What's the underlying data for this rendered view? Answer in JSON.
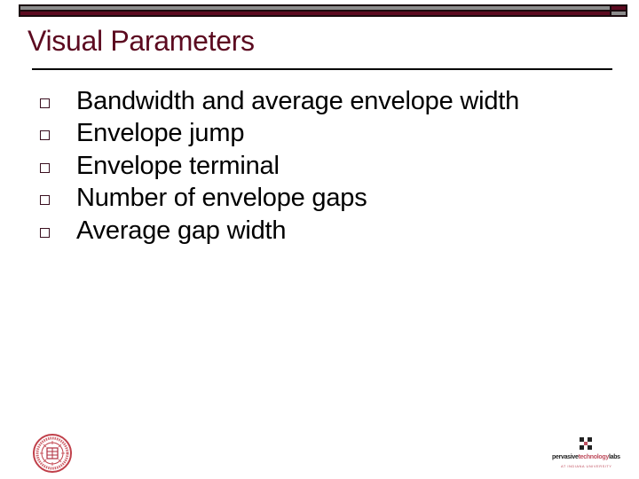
{
  "slide": {
    "title": "Visual Parameters",
    "bullets": [
      {
        "text": "Bandwidth and average envelope width"
      },
      {
        "text": "Envelope jump"
      },
      {
        "text": "Envelope terminal"
      },
      {
        "text": "Number of envelope gaps"
      },
      {
        "text": "Average gap width"
      }
    ]
  },
  "colors": {
    "accent_maroon": "#5c0a20",
    "accent_gray": "#8c8c8c"
  },
  "logos": {
    "left": "university-seal",
    "right": {
      "name_dark": "pervasive",
      "name_red": "technology",
      "name_dark2": "labs",
      "sub": "AT INDIANA UNIVERSITY"
    }
  }
}
